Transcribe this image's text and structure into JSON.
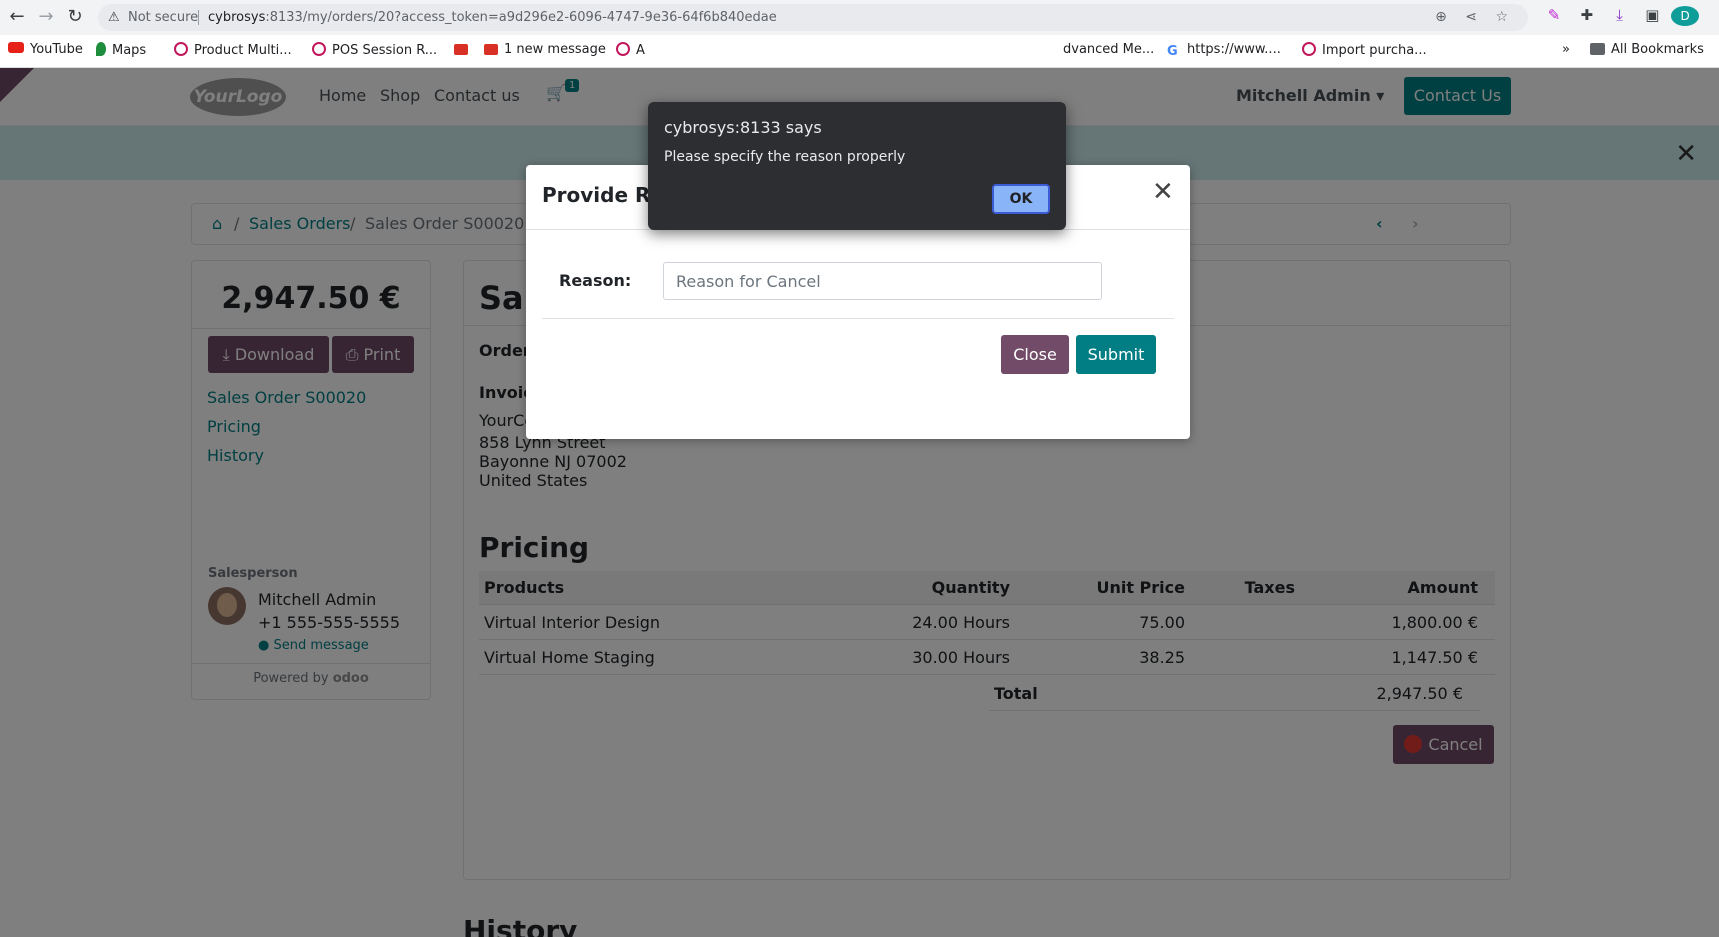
{
  "browser": {
    "security_label": "Not secure",
    "url_host": "cybrosys",
    "url_rest": ":8133/my/orders/20?access_token=a9d296e2-6096-4747-9e36-64f6b840edae",
    "profile_initial": "D"
  },
  "bookmarks": {
    "items": [
      "YouTube",
      "Maps",
      "Product Multi...",
      "POS Session R...",
      "1 new message",
      "A",
      "dvanced Me...",
      "https://www....",
      "Import purcha..."
    ],
    "more": "»",
    "all_label": "All Bookmarks"
  },
  "site": {
    "logo_text": "YourLogo",
    "menu": [
      "Home",
      "Shop",
      "Contact us"
    ],
    "cart_count": "1",
    "user_name": "Mitchell Admin",
    "contact_button": "Contact Us"
  },
  "breadcrumb": {
    "sep": "/",
    "link": "Sales Orders",
    "current": "Sales Order S00020"
  },
  "sidebar": {
    "amount": "2,947.50 €",
    "download_label": "Download",
    "print_label": "Print",
    "links": [
      "Sales Order S00020",
      "Pricing",
      "History"
    ],
    "salesperson_label": "Salesperson",
    "salesperson_name": "Mitchell Admin",
    "salesperson_phone": "+1 555-555-5555",
    "send_message": "Send message",
    "powered_by": "Powered by",
    "powered_brand": "odoo"
  },
  "order": {
    "title_partial": "Sal",
    "order_date_partial": "Order",
    "address_title": "Invoicing and Shipping Address:",
    "address_lines": [
      "YourCompany, Joel Willis",
      "858 Lynn Street",
      "Bayonne NJ 07002",
      "United States"
    ],
    "pricing_title": "Pricing",
    "columns": [
      "Products",
      "Quantity",
      "Unit Price",
      "Taxes",
      "Amount"
    ],
    "rows": [
      {
        "product": "Virtual Interior Design",
        "quantity": "24.00 Hours",
        "unit_price": "75.00",
        "taxes": "",
        "amount": "1,800.00 €"
      },
      {
        "product": "Virtual Home Staging",
        "quantity": "30.00 Hours",
        "unit_price": "38.25",
        "taxes": "",
        "amount": "1,147.50 €"
      }
    ],
    "total_label": "Total",
    "total_value": "2,947.50 €",
    "cancel_label": "Cancel",
    "history_title": "History"
  },
  "modal": {
    "title": "Provide Rea",
    "reason_label": "Reason:",
    "reason_placeholder": "Reason for Cancel",
    "close_label": "Close",
    "submit_label": "Submit"
  },
  "js_dialog": {
    "title": "cybrosys:8133 says",
    "message": "Please specify the reason properly",
    "ok_label": "OK"
  },
  "colors": {
    "primary": "#714b67",
    "accent": "#017e84",
    "dialog_bg": "#2d2e31"
  }
}
